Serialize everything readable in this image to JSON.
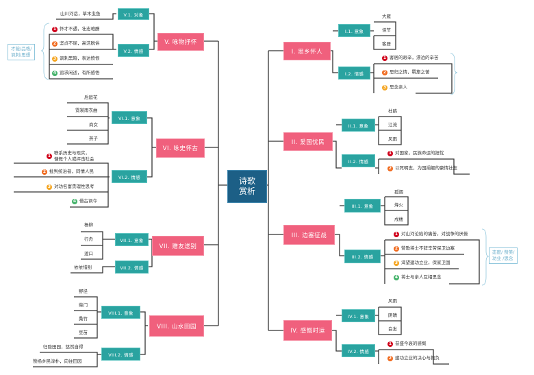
{
  "root": {
    "line1": "诗歌",
    "line2": "赏析"
  },
  "colors": {
    "root": "#1c5f86",
    "main": "#f0607d",
    "sub": "#2aa3a0",
    "line": "#333333",
    "brace": "#8fc6dc",
    "badge1": "#d0021b",
    "badge2": "#f06a1e",
    "badge3": "#f5a623",
    "badge4": "#45b36b"
  },
  "branches": {
    "b1": {
      "label": "I. 思乡怀人",
      "s1": {
        "label": "I.1. 意象",
        "leaves": [
          "大雁",
          "佳节",
          "客居"
        ]
      },
      "s2": {
        "label": "I.2. 情感",
        "leaves": [
          {
            "n": "1",
            "text": "客居的艰辛，漂泊的辛苦"
          },
          {
            "n": "2",
            "text": "思归之情，羁旅之苦"
          },
          {
            "n": "3",
            "text": "思念亲人"
          }
        ]
      }
    },
    "b2": {
      "label": "II. 爱国忧民",
      "s1": {
        "label": "II.1. 意象",
        "leaves": [
          "杜鹃",
          "江流",
          "风雨"
        ]
      },
      "s2": {
        "label": "II.2. 情感",
        "leaves": [
          {
            "n": "1",
            "text": "对国家，民族命运的担忧"
          },
          {
            "n": "2",
            "text": "以死明志，为国捐躯的豪情壮志"
          }
        ]
      }
    },
    "b3": {
      "label": "III. 边塞征战",
      "s1": {
        "label": "III.1. 意象",
        "leaves": [
          "孤烟",
          "烽火",
          "戍楼"
        ]
      },
      "s2": {
        "label": "III.2. 情感",
        "leaves": [
          {
            "n": "1",
            "text": "对山河沦陷的痛苦，对战争的厌倦"
          },
          {
            "n": "2",
            "text": "赞歌将士不辞辛劳保卫边塞"
          },
          {
            "n": "3",
            "text": "渴望建功立业，保家卫国"
          },
          {
            "n": "4",
            "text": "将士与亲人互相思念"
          }
        ]
      },
      "note": {
        "line1": "态度/ 赞美/",
        "line2": "功业 /思念"
      }
    },
    "b4": {
      "label": "IV. 感慨时运",
      "s1": {
        "label": "IV.1. 意象",
        "leaves": [
          "风雨",
          "阴晴",
          "白发"
        ]
      },
      "s2": {
        "label": "IV.2. 情感",
        "leaves": [
          {
            "n": "1",
            "text": "昔盛今衰的感慨"
          },
          {
            "n": "2",
            "text": "建功立业的决心与抱负"
          }
        ]
      }
    },
    "b5": {
      "label": "V. 咏物抒怀",
      "s1": {
        "label": "V.1. 对象",
        "leaves": [
          "山川河岳，草木虫鱼"
        ]
      },
      "s2": {
        "label": "V.2. 情感",
        "leaves": [
          {
            "n": "1",
            "text": "怀才不遇，壮志难酬"
          },
          {
            "n": "2",
            "text": "坚贞不屈，高洁脱俗"
          },
          {
            "n": "3",
            "text": "讽刺黑暗，表达愤恨"
          },
          {
            "n": "4",
            "text": "追求闲适，有所感悟"
          }
        ]
      },
      "note": {
        "line1": "才能/品格/",
        "line2": "讽刺/思想"
      }
    },
    "b6": {
      "label": "VI. 咏史怀古",
      "s1": {
        "label": "VI.1. 意象",
        "leaves": [
          "后庭花",
          "霓裳雨衣曲",
          "商女",
          "燕子"
        ]
      },
      "s2": {
        "label": "VI.2. 情感",
        "leaves": [
          {
            "n": "1",
            "text": "联系历史与现实，",
            "text2": "慷慨个人或抨击社会"
          },
          {
            "n": "2",
            "text": "批判统治者，同情人民"
          },
          {
            "n": "3",
            "text": "对功名富贵理性思考"
          },
          {
            "n": "4",
            "text": "借古讽今"
          }
        ]
      }
    },
    "b7": {
      "label": "VII. 赠友送别",
      "s1": {
        "label": "VII.1. 意象",
        "leaves": [
          "杨柳",
          "行舟",
          "渡口"
        ]
      },
      "s2": {
        "label": "VII.2. 情感",
        "leaves": [
          "依依惜别"
        ]
      }
    },
    "b8": {
      "label": "VIII. 山水田园",
      "s1": {
        "label": "VIII.1. 意象",
        "leaves": [
          "野径",
          "柴门",
          "桑竹",
          "豆苗"
        ]
      },
      "s2": {
        "label": "VIII.2. 情感",
        "leaves": [
          "归隐田园，悠然自得",
          "赞扬乡民淳朴，向往田园"
        ]
      }
    }
  }
}
